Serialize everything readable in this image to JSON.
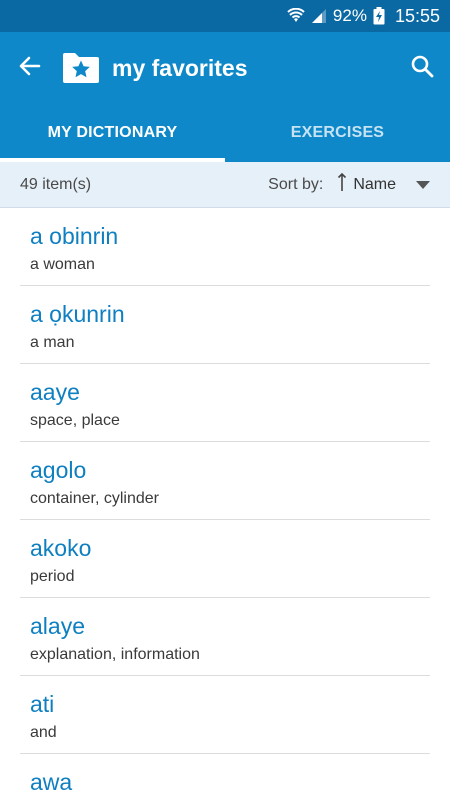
{
  "status_bar": {
    "battery": "92%",
    "time": "15:55"
  },
  "app_bar": {
    "title": "my favorites"
  },
  "tabs": [
    {
      "label": "MY DICTIONARY",
      "active": true
    },
    {
      "label": "EXERCISES",
      "active": false
    }
  ],
  "sub_header": {
    "count": "49 item(s)",
    "sort_label": "Sort by:",
    "sort_value": "Name"
  },
  "items": [
    {
      "word": "a obinrin",
      "meaning": "a woman"
    },
    {
      "word": "a ọkunrin",
      "meaning": "a man"
    },
    {
      "word": "aaye",
      "meaning": "space, place"
    },
    {
      "word": "agolo",
      "meaning": "container, cylinder"
    },
    {
      "word": "akoko",
      "meaning": "period"
    },
    {
      "word": "alaye",
      "meaning": "explanation, information"
    },
    {
      "word": "ati",
      "meaning": "and"
    },
    {
      "word": "awa",
      "meaning": ""
    }
  ],
  "colors": {
    "primary": "#0e88c9",
    "status_bar": "#0a68a3",
    "word": "#0e7fc0",
    "sub_header_bg": "#e6f0f8"
  }
}
